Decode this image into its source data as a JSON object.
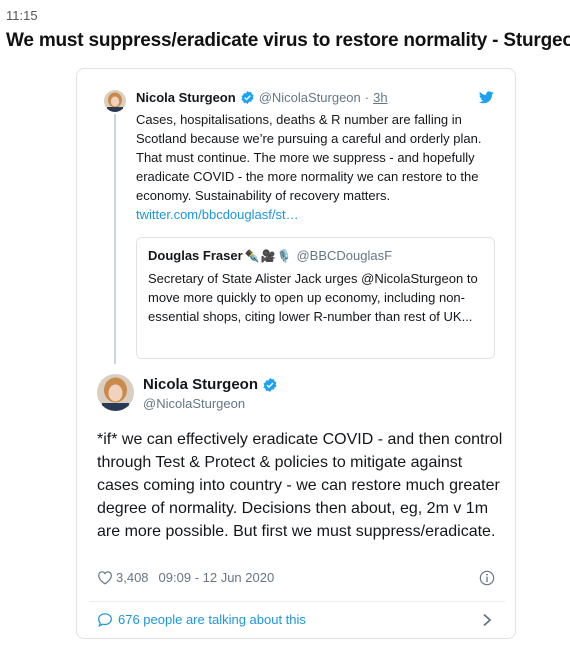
{
  "header": {
    "time": "11:15",
    "headline": "We must suppress/eradicate virus to restore normality - Sturgeon"
  },
  "quoted_tweet": {
    "name": "Nicola Sturgeon",
    "handle": "@NicolaSturgeon",
    "separator": "·",
    "time": "3h",
    "text": "Cases, hospitalisations, deaths & R number are falling in Scotland because we’re pursuing a careful and orderly plan. That must continue. The more we suppress - and hopefully eradicate COVID - the more normality we can restore to the economy. Sustainability of recovery matters. ",
    "link": "twitter.com/bbcdouglasf/st…",
    "inner": {
      "name": "Douglas Fraser",
      "emoji": "✒️🎥🎙️",
      "handle": "@BBCDouglasF",
      "text": "Secretary of State Alister Jack urges @NicolaSturgeon to move more quickly to open up economy, including non-essential shops, citing lower R-number than rest of UK..."
    }
  },
  "main_tweet": {
    "name": "Nicola Sturgeon",
    "handle": "@NicolaSturgeon",
    "text": "*if* we can effectively eradicate COVID - and then control through Test & Protect & policies to mitigate against cases coming into country - we can restore much greater degree of normality. Decisions then about, eg, 2m v 1m are more possible. But first we must suppress/eradicate.",
    "likes": "3,408",
    "timestamp": "09:09 - 12 Jun 2020",
    "talking": "676 people are talking about this"
  },
  "colors": {
    "twitter_blue": "#1da1f2",
    "link_blue": "#1b95e0",
    "secondary_text": "#657786"
  },
  "icons": [
    "verified-badge-icon",
    "twitter-bird-icon",
    "heart-icon",
    "info-icon",
    "comment-bubble-icon",
    "chevron-right-icon"
  ]
}
